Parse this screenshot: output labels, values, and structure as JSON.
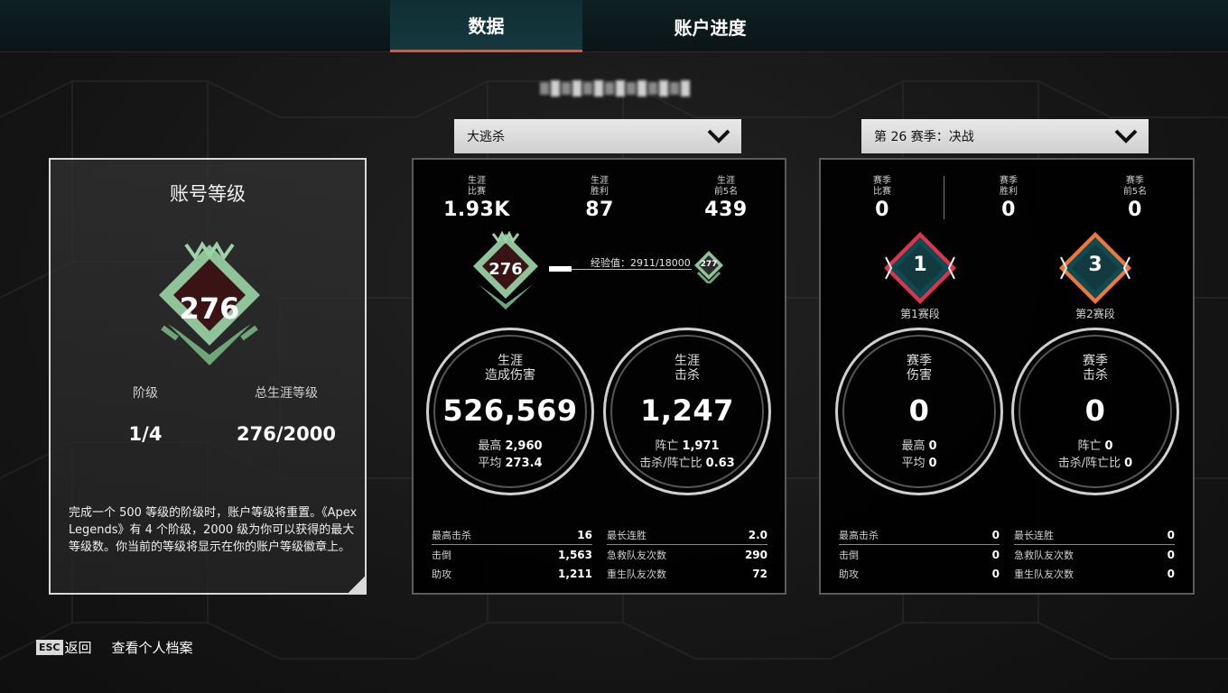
{
  "tabs": [
    {
      "label": "数据",
      "active": true
    },
    {
      "label": "账户进度",
      "active": false
    }
  ],
  "player_name": "",
  "dropdowns": {
    "mode": "大逃杀",
    "season": "第 26 赛季：决战"
  },
  "account": {
    "title": "账号等级",
    "badge_level": "276",
    "tier_label": "阶级",
    "total_label": "总生涯等级",
    "tier_value": "1/4",
    "total_value": "276/2000",
    "description": "完成一个 500 等级的阶级时，账户等级将重置。《Apex Legends》有 4 个阶级，2000 级为你可以获得的最大等级数。你当前的等级将显示在你的账户等级徽章上。"
  },
  "career": {
    "top": [
      {
        "l1": "生涯",
        "l2": "比赛",
        "value": "1.93K"
      },
      {
        "l1": "生涯",
        "l2": "胜利",
        "value": "87"
      },
      {
        "l1": "生涯",
        "l2": "前5名",
        "value": "439"
      }
    ],
    "badge_level": "276",
    "next_level": "277",
    "xp_text": "经验值：2911/18000",
    "xp_progress": 0.16,
    "damage": {
      "title1": "生涯",
      "title2": "造成伤害",
      "value": "526,569",
      "sub1_label": "最高",
      "sub1_value": "2,960",
      "sub2_label": "平均",
      "sub2_value": "273.4"
    },
    "kills": {
      "title1": "生涯",
      "title2": "击杀",
      "value": "1,247",
      "sub1_label": "阵亡",
      "sub1_value": "1,971",
      "sub2_label": "击杀/阵亡比",
      "sub2_value": "0.63"
    },
    "left_stats": [
      {
        "label": "最高击杀",
        "value": "16"
      },
      {
        "label": "击倒",
        "value": "1,563"
      },
      {
        "label": "助攻",
        "value": "1,211"
      }
    ],
    "right_stats": [
      {
        "label": "最长连胜",
        "value": "2.0"
      },
      {
        "label": "急救队友次数",
        "value": "290"
      },
      {
        "label": "重生队友次数",
        "value": "72"
      }
    ]
  },
  "season": {
    "top": [
      {
        "l1": "赛季",
        "l2": "比赛",
        "value": "0"
      },
      {
        "l1": "赛季",
        "l2": "胜利",
        "value": "0"
      },
      {
        "l1": "赛季",
        "l2": "前5名",
        "value": "0"
      }
    ],
    "split1": {
      "num": "1",
      "label": "第1赛段",
      "color": "#e0334a"
    },
    "split2": {
      "num": "3",
      "label": "第2赛段",
      "color": "#f0763a"
    },
    "damage": {
      "title1": "赛季",
      "title2": "伤害",
      "value": "0",
      "sub1_label": "最高",
      "sub1_value": "0",
      "sub2_label": "平均",
      "sub2_value": "0"
    },
    "kills": {
      "title1": "赛季",
      "title2": "击杀",
      "value": "0",
      "sub1_label": "阵亡",
      "sub1_value": "0",
      "sub2_label": "击杀/阵亡比",
      "sub2_value": "0"
    },
    "left_stats": [
      {
        "label": "最高击杀",
        "value": "0"
      },
      {
        "label": "击倒",
        "value": "0"
      },
      {
        "label": "助攻",
        "value": "0"
      }
    ],
    "right_stats": [
      {
        "label": "最长连胜",
        "value": "0"
      },
      {
        "label": "急救队友次数",
        "value": "0"
      },
      {
        "label": "重生队友次数",
        "value": "0"
      }
    ]
  },
  "footer": {
    "esc_key": "ESC",
    "back_label": "返回",
    "profile_label": "查看个人档案"
  },
  "colors": {
    "accent": "#e8532b",
    "badge_green": "#8fc49a",
    "badge_dark": "#3a1414"
  }
}
